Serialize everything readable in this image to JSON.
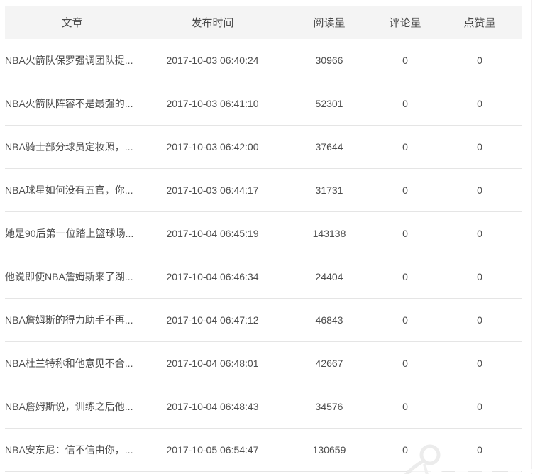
{
  "table": {
    "columns": [
      {
        "key": "title",
        "label": "文章"
      },
      {
        "key": "publish_time",
        "label": "发布时间"
      },
      {
        "key": "reads",
        "label": "阅读量"
      },
      {
        "key": "comments",
        "label": "评论量"
      },
      {
        "key": "likes",
        "label": "点赞量"
      }
    ],
    "rows": [
      {
        "title": "NBA火箭队保罗强调团队提...",
        "publish_time": "2017-10-03 06:40:24",
        "reads": "30966",
        "comments": "0",
        "likes": "0"
      },
      {
        "title": "NBA火箭队阵容不是最强的...",
        "publish_time": "2017-10-03 06:41:10",
        "reads": "52301",
        "comments": "0",
        "likes": "0"
      },
      {
        "title": "NBA骑士部分球员定妆照，...",
        "publish_time": "2017-10-03 06:42:00",
        "reads": "37644",
        "comments": "0",
        "likes": "0"
      },
      {
        "title": "NBA球星如何没有五官，你...",
        "publish_time": "2017-10-03 06:44:17",
        "reads": "31731",
        "comments": "0",
        "likes": "0"
      },
      {
        "title": "她是90后第一位踏上篮球场...",
        "publish_time": "2017-10-04 06:45:19",
        "reads": "143138",
        "comments": "0",
        "likes": "0"
      },
      {
        "title": "他说即使NBA詹姆斯来了湖...",
        "publish_time": "2017-10-04 06:46:34",
        "reads": "24404",
        "comments": "0",
        "likes": "0"
      },
      {
        "title": "NBA詹姆斯的得力助手不再...",
        "publish_time": "2017-10-04 06:47:12",
        "reads": "46843",
        "comments": "0",
        "likes": "0"
      },
      {
        "title": "NBA杜兰特称和他意见不合...",
        "publish_time": "2017-10-04 06:48:01",
        "reads": "42667",
        "comments": "0",
        "likes": "0"
      },
      {
        "title": "NBA詹姆斯说，训练之后他...",
        "publish_time": "2017-10-04 06:48:43",
        "reads": "34576",
        "comments": "0",
        "likes": "0"
      },
      {
        "title": "NBA安东尼：信不信由你，...",
        "publish_time": "2017-10-05 06:54:47",
        "reads": "130659",
        "comments": "0",
        "likes": "0"
      }
    ]
  },
  "watermark": {
    "logo_icon": "ribbon-p-logo"
  },
  "colors": {
    "header_bg": "#f4f4f4",
    "row_border": "#e5e5e5",
    "text": "#4d4d4d"
  }
}
